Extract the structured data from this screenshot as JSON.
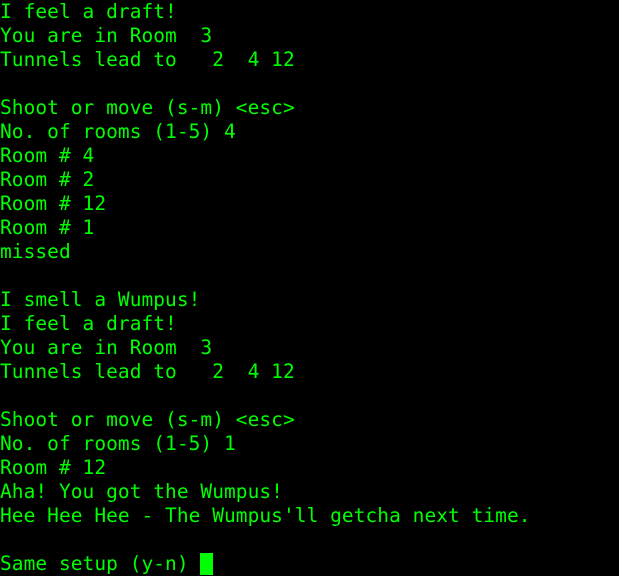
{
  "terminal": {
    "foreground_color": "#00ff00",
    "background_color": "#000000",
    "cursor_color": "#00ff00",
    "lines": [
      "I feel a draft!",
      "You are in Room  3",
      "Tunnels lead to   2  4 12",
      "",
      "Shoot or move (s-m) <esc>",
      "No. of rooms (1-5) 4",
      "Room # 4",
      "Room # 2",
      "Room # 12",
      "Room # 1",
      "missed",
      "",
      "I smell a Wumpus!",
      "I feel a draft!",
      "You are in Room  3",
      "Tunnels lead to   2  4 12",
      "",
      "Shoot or move (s-m) <esc>",
      "No. of rooms (1-5) 1",
      "Room # 12",
      "Aha! You got the Wumpus!",
      "Hee Hee Hee - The Wumpus'll getcha next time.",
      "",
      "Same setup (y-n) "
    ]
  }
}
